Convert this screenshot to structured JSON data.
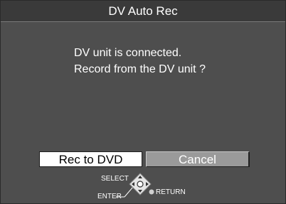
{
  "dialog": {
    "title": "DV Auto Rec",
    "message_line1": "DV unit is connected.",
    "message_line2": "Record from the DV unit ?"
  },
  "buttons": {
    "primary_label": "Rec to DVD",
    "secondary_label": "Cancel"
  },
  "legend": {
    "select_label": "SELECT",
    "enter_label": "ENTER",
    "return_label": "RETURN",
    "joystick_icon": "joystick-icon",
    "return_icon": "return-dot-icon"
  },
  "colors": {
    "panel": "#4e4e4e",
    "selected_button": "#ffffff",
    "unselected_button": "#9a9a9a"
  }
}
